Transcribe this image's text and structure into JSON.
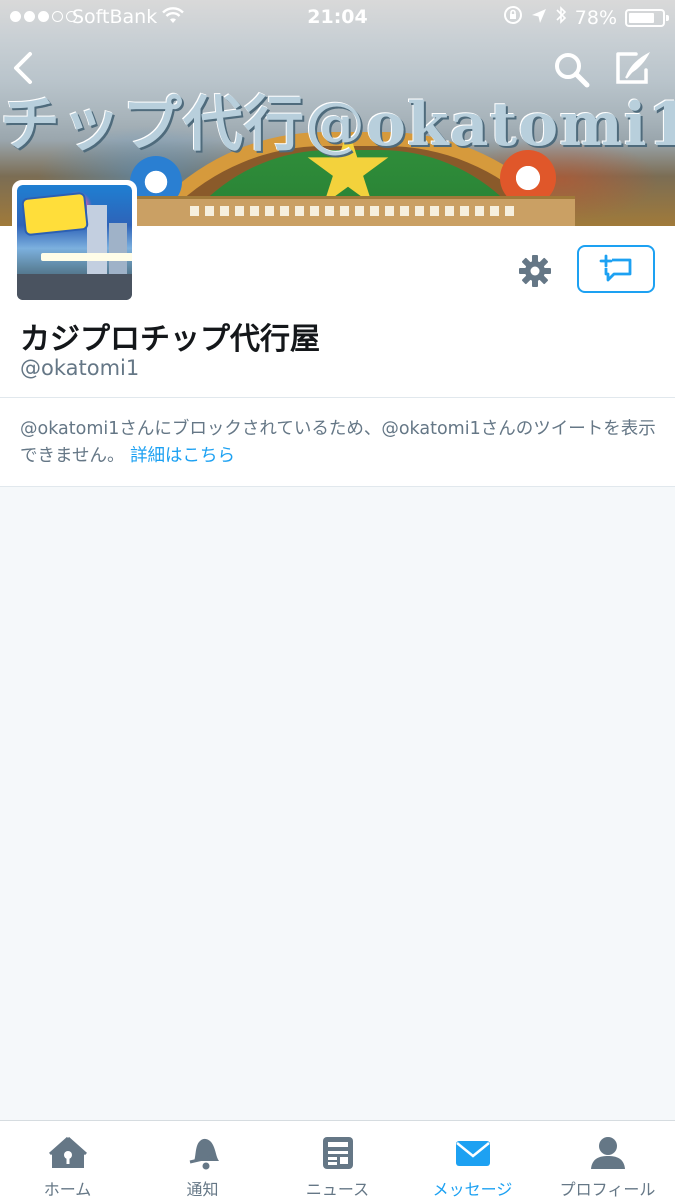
{
  "status_bar": {
    "carrier": "SoftBank",
    "time": "21:04",
    "battery_percent": "78%",
    "battery_level": 0.78,
    "signal_bars_filled": 3,
    "signal_bars_total": 5
  },
  "banner": {
    "title_text": "チップ代行@okatomi1"
  },
  "profile": {
    "display_name": "カジプロチップ代行屋",
    "screen_name": "@okatomi1"
  },
  "blocked": {
    "message": "@okatomi1さんにブロックされているため、@okatomi1さんのツイートを表示できません。",
    "link_text": "詳細はこちら"
  },
  "tab_bar": {
    "tabs": [
      {
        "label": "ホーム",
        "icon": "home-icon"
      },
      {
        "label": "通知",
        "icon": "bell-icon"
      },
      {
        "label": "ニュース",
        "icon": "news-icon"
      },
      {
        "label": "メッセージ",
        "icon": "envelope-icon",
        "active": true
      },
      {
        "label": "プロフィール",
        "icon": "person-icon"
      }
    ]
  },
  "colors": {
    "accent": "#1da1f2",
    "secondary_text": "#657786",
    "background": "#f5f8fa"
  }
}
